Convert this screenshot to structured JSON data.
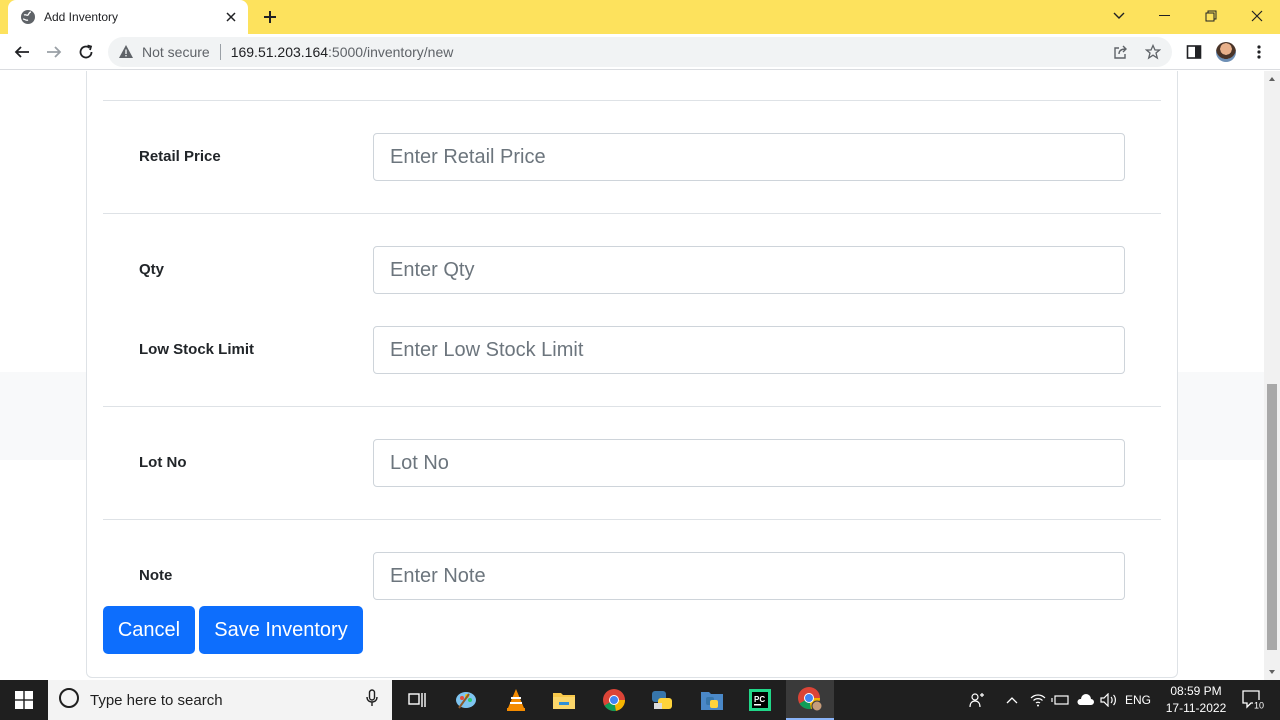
{
  "browser": {
    "tab_title": "Add Inventory",
    "security_label": "Not secure",
    "url_host": "169.51.203.164",
    "url_path": ":5000/inventory/new"
  },
  "form": {
    "fields": [
      {
        "label": "Retail Price",
        "placeholder": "Enter Retail Price",
        "value": ""
      },
      {
        "label": "Qty",
        "placeholder": "Enter Qty",
        "value": ""
      },
      {
        "label": "Low Stock Limit",
        "placeholder": "Enter Low Stock Limit",
        "value": ""
      },
      {
        "label": "Lot No",
        "placeholder": "Lot No",
        "value": ""
      },
      {
        "label": "Note",
        "placeholder": "Enter Note",
        "value": ""
      }
    ],
    "cancel_label": "Cancel",
    "save_label": "Save Inventory"
  },
  "colors": {
    "tab_strip": "#fde25d",
    "primary_button": "#0d6efd"
  },
  "taskbar": {
    "search_placeholder": "Type here to search",
    "language": "ENG",
    "time": "08:59 PM",
    "date": "17-11-2022",
    "notification_count": "10",
    "apps": [
      "task-view-icon",
      "paint-icon",
      "vlc-icon",
      "file-explorer-icon",
      "chrome-icon",
      "python-icon",
      "python-folder-icon",
      "pycharm-icon",
      "chrome-profile-icon"
    ]
  }
}
